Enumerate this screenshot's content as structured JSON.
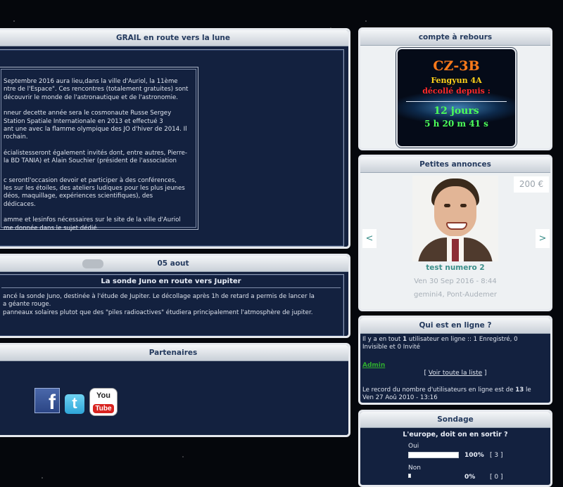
{
  "grail": {
    "title": "GRAIL en route vers la lune",
    "paragraphs": [
      "Septembre 2016 aura lieu,dans la ville d'Auriol, la 11ème",
      "ntre de l'Espace\". Ces rencontres (totalement gratuites) sont",
      "découvrir le monde de l'astronautique et de l'astronomie.",
      "nneur decette année sera le cosmonaute Russe Sergey",
      "Station Spatiale Internationale en 2013 et effectué 3",
      "ant une avec la flamme olympique des JO d'hiver de 2014. Il",
      "rochain.",
      "écialistesseront également invités dont, entre autres, Pierre-",
      "la BD TANIA) et Alain Souchier (président de l'association",
      "c serontl'occasion devoir et participer à des conférences,",
      "les sur les étoiles, des ateliers ludiques pour les plus jeunes",
      "déos, maquillage, expériences scientifiques), des",
      "dédicaces.",
      "amme et lesinfos nécessaires sur le site de la ville d'Auriol",
      "me donnée dans le sujet dédié."
    ]
  },
  "juno": {
    "header": "05 aout",
    "title": "La sonde Juno en route vers Jupiter",
    "lines": [
      "ancé la sonde Juno, destinée à l'étude de Jupiter. Le décollage après 1h de retard a permis de lancer la",
      "a géante rouge.",
      "panneaux solaires plutot que des \"piles radioactives\" étudiera principalement l'atmosphère de jupiter."
    ]
  },
  "partenaires": {
    "title": "Partenaires",
    "logos": [
      "facebook-icon",
      "twitter-icon",
      "youtube-icon"
    ],
    "facebook_letter": "f",
    "twitter_letter": "t",
    "youtube_top": "You",
    "youtube_bottom": "Tube"
  },
  "countdown": {
    "title": "compte à rebours",
    "rocket": "CZ-3B",
    "payload": "Fengyun 4A",
    "status": "décollé depuis :",
    "days": "12 jours",
    "time": "5 h 20 m 41 s"
  },
  "annonces": {
    "title": "Petites annonces",
    "price": "200 €",
    "prev": "<",
    "next": ">",
    "item_title": "test numero 2",
    "date": "Ven 30 Sep 2016 - 8:44",
    "location": "gemini4, Pont-Audemer"
  },
  "online": {
    "title": "Qui est en ligne ?",
    "line1_pre": "Il y a en tout ",
    "line1_count": "1",
    "line1_post": " utilisateur en ligne :: 1 Enregistré, 0",
    "line2": "Invisible et 0 Invité",
    "admin": "Admin",
    "list_open": "[ ",
    "list_link": "Voir toute la liste",
    "list_close": " ]",
    "record_pre": "Le record du nombre d'utilisateurs en ligne est de ",
    "record_count": "13",
    "record_post": " le",
    "record_date": "Ven 27 Aoû 2010 - 13:16"
  },
  "sondage": {
    "title": "Sondage",
    "question": "L'europe, doit on en sortir ?",
    "options": [
      {
        "label": "Oui",
        "percent_text": "100%",
        "count": "[ 3 ]",
        "fill": 1.0
      },
      {
        "label": "Non",
        "percent_text": "0%",
        "count": "[ 0 ]",
        "fill": 0.0
      }
    ]
  },
  "colors": {
    "panel_bg": "#13213f",
    "countdown_rocket": "#ff7a1a",
    "countdown_payload": "#ffd21a",
    "countdown_status": "#ff2a2a",
    "countdown_days": "#4cff59",
    "link_teal": "#3b8f8a",
    "admin_green": "#2fae2f"
  }
}
